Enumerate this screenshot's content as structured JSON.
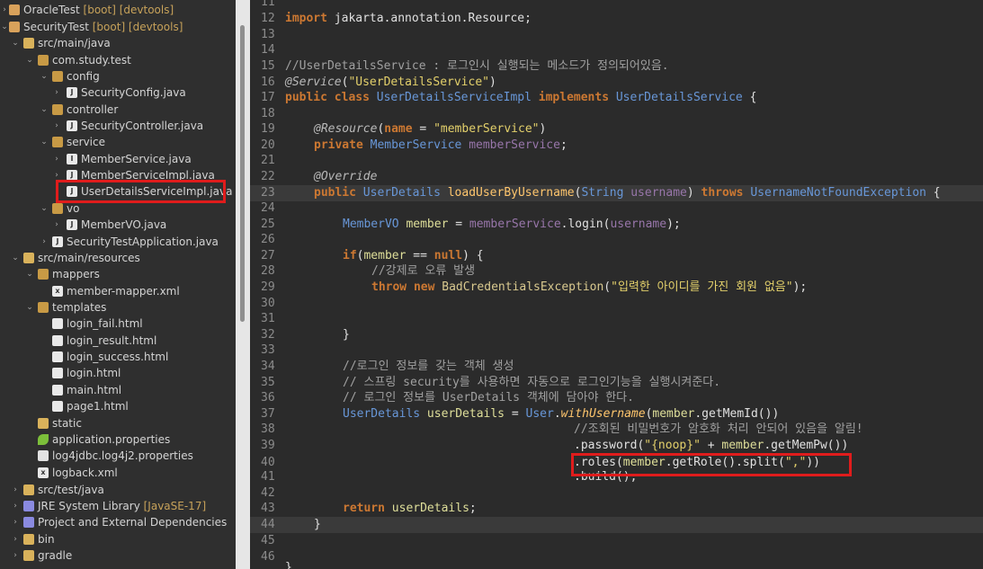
{
  "explorer": {
    "items": [
      {
        "label": "OracleTest",
        "decoration": "[boot] [devtools]"
      },
      {
        "label": "SecurityTest",
        "decoration": "[boot] [devtools]"
      },
      {
        "label": "src/main/java",
        "decoration": ""
      },
      {
        "label": "com.study.test",
        "decoration": ""
      },
      {
        "label": "config",
        "decoration": ""
      },
      {
        "label": "SecurityConfig.java",
        "decoration": ""
      },
      {
        "label": "controller",
        "decoration": ""
      },
      {
        "label": "SecurityController.java",
        "decoration": ""
      },
      {
        "label": "service",
        "decoration": ""
      },
      {
        "label": "MemberService.java",
        "decoration": ""
      },
      {
        "label": "MemberServiceImpl.java",
        "decoration": ""
      },
      {
        "label": "UserDetailsServiceImpl.java",
        "decoration": ""
      },
      {
        "label": "vo",
        "decoration": ""
      },
      {
        "label": "MemberVO.java",
        "decoration": ""
      },
      {
        "label": "SecurityTestApplication.java",
        "decoration": ""
      },
      {
        "label": "src/main/resources",
        "decoration": ""
      },
      {
        "label": "mappers",
        "decoration": ""
      },
      {
        "label": "member-mapper.xml",
        "decoration": ""
      },
      {
        "label": "templates",
        "decoration": ""
      },
      {
        "label": "login_fail.html",
        "decoration": ""
      },
      {
        "label": "login_result.html",
        "decoration": ""
      },
      {
        "label": "login_success.html",
        "decoration": ""
      },
      {
        "label": "login.html",
        "decoration": ""
      },
      {
        "label": "main.html",
        "decoration": ""
      },
      {
        "label": "page1.html",
        "decoration": ""
      },
      {
        "label": "static",
        "decoration": ""
      },
      {
        "label": "application.properties",
        "decoration": ""
      },
      {
        "label": "log4jdbc.log4j2.properties",
        "decoration": ""
      },
      {
        "label": "logback.xml",
        "decoration": ""
      },
      {
        "label": "src/test/java",
        "decoration": ""
      },
      {
        "label": "JRE System Library",
        "decoration": "[JavaSE-17]"
      },
      {
        "label": "Project and External Dependencies",
        "decoration": ""
      },
      {
        "label": "bin",
        "decoration": ""
      },
      {
        "label": "gradle",
        "decoration": ""
      }
    ]
  },
  "editor": {
    "line_numbers": [
      "11",
      "12",
      "13",
      "14",
      "15",
      "16",
      "17",
      "18",
      "19",
      "20",
      "21",
      "22",
      "23",
      "24",
      "25",
      "26",
      "27",
      "28",
      "29",
      "30",
      "31",
      "32",
      "33",
      "34",
      "35",
      "36",
      "37",
      "38",
      "39",
      "40",
      "41",
      "42",
      "43",
      "44",
      "45",
      "46"
    ],
    "code": {
      "l12": {
        "a": "import",
        "b": " jakarta.annotation.Resource;"
      },
      "l15": "//UserDetailsService : 로그인시 실행되는 메소드가 정의되어있음.",
      "l16": {
        "a": "@Service",
        "b": "(",
        "c": "\"UserDetailsService\"",
        "d": ")"
      },
      "l17": {
        "a": "public class ",
        "b": "UserDetailsServiceImpl",
        "c": " implements ",
        "d": "UserDetailsService",
        "e": " {"
      },
      "l19": {
        "a": "@Resource",
        "b": "(",
        "c": "name",
        "d": " = ",
        "e": "\"memberService\"",
        "f": ")"
      },
      "l20": {
        "a": "private ",
        "b": "MemberService",
        "c": " memberService",
        "d": ";"
      },
      "l22": "@Override",
      "l23": {
        "a": "public ",
        "b": "UserDetails",
        "c": " loadUserByUsername",
        "d": "(",
        "e": "String",
        "f": " username",
        "g": ") ",
        "h": "throws ",
        "i": "UsernameNotFoundException",
        "j": " {"
      },
      "l25": {
        "a": "MemberVO",
        "b": " member",
        "c": " = ",
        "d": "memberService",
        "e": ".login(",
        "f": "username",
        "g": ");"
      },
      "l27": {
        "a": "if",
        "b": "(",
        "c": "member",
        "d": " == ",
        "e": "null",
        "f": ") {"
      },
      "l28": "//강제로 오류 발생",
      "l29": {
        "a": "throw new ",
        "b": "BadCredentialsException",
        "c": "(",
        "d": "\"입력한 아이디를 가진 회원 없음\"",
        "e": ");"
      },
      "l32": "}",
      "l34": "//로그인 정보를 갖는 객체 생성",
      "l35": "// 스프링 security를 사용하면 자동으로 로그인기능을 실행시켜준다.",
      "l36": "// 로그인 정보를 UserDetails 객체에 담아야 한다.",
      "l37": {
        "a": "UserDetails",
        "b": " userDetails",
        "c": " = ",
        "d": "User",
        "e": ".",
        "f": "withUsername",
        "g": "(",
        "h": "member",
        "i": ".getMemId())"
      },
      "l38": "//조회된 비밀번호가 암호화 처리 안되어 있음을 알림!",
      "l39": {
        "a": ".password(",
        "b": "\"{noop}\"",
        "c": " + ",
        "d": "member",
        "e": ".getMemPw())"
      },
      "l40": {
        "a": ".roles(",
        "b": "member",
        "c": ".getRole().split(",
        "d": "\",\"",
        "e": "))"
      },
      "l41": ".build();",
      "l43": {
        "a": "return ",
        "b": "userDetails",
        "c": ";"
      },
      "l44": "}",
      "l46": "}"
    }
  },
  "colors": {
    "highlight_box": "#e01c1c",
    "keyword": "#cc7832",
    "type": "#6897d8",
    "string": "#e3d06b"
  }
}
